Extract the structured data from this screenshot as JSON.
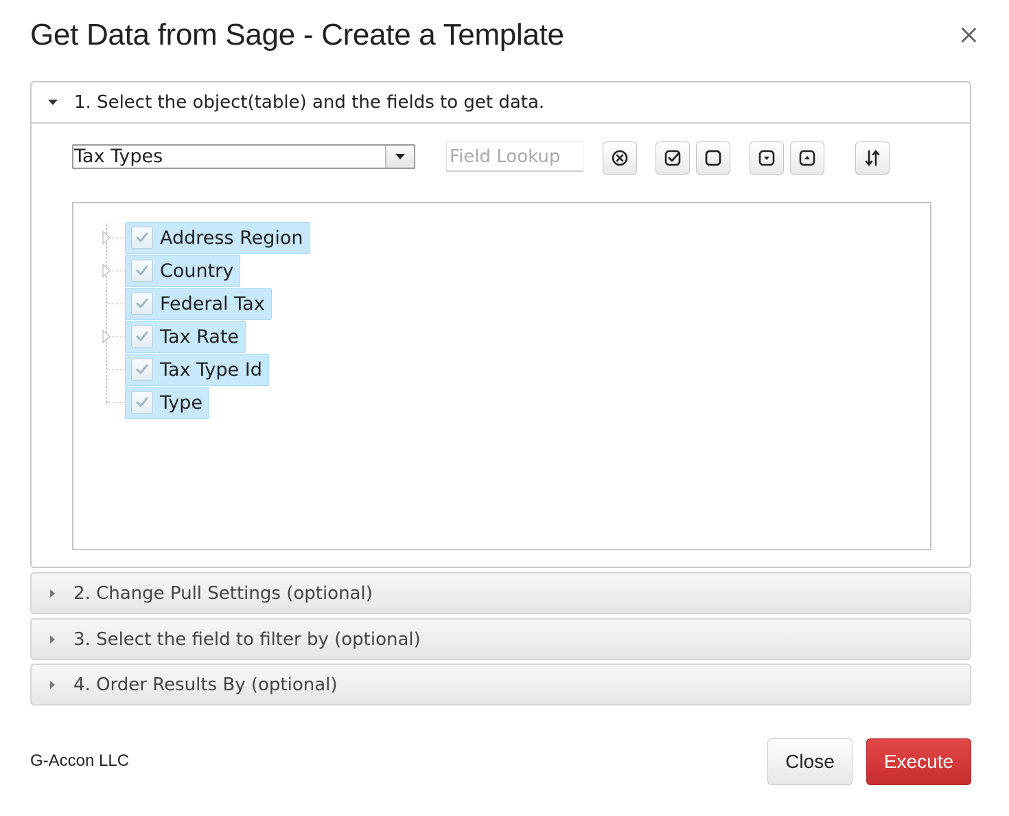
{
  "dialog": {
    "title": "Get Data from Sage - Create a Template"
  },
  "section1": {
    "label": "1. Select the object(table) and the fields to get data.",
    "expanded": true,
    "object_select": {
      "value": "Tax Types"
    },
    "field_lookup": {
      "placeholder": "Field Lookup",
      "value": ""
    },
    "toolbar": [
      {
        "name": "clear-lookup",
        "icon": "circle-x-icon"
      },
      {
        "name": "check-all",
        "icon": "check-square-icon"
      },
      {
        "name": "uncheck-all",
        "icon": "empty-square-icon"
      },
      {
        "name": "expand-all",
        "icon": "square-chevron-down-icon"
      },
      {
        "name": "collapse-all",
        "icon": "square-chevron-up-icon"
      },
      {
        "name": "sort-fields",
        "icon": "sort-arrows-icon"
      }
    ],
    "fields": [
      {
        "label": "Address Region",
        "checked": true,
        "expandable": true
      },
      {
        "label": "Country",
        "checked": true,
        "expandable": true
      },
      {
        "label": "Federal Tax",
        "checked": true,
        "expandable": false
      },
      {
        "label": "Tax Rate",
        "checked": true,
        "expandable": true
      },
      {
        "label": "Tax Type Id",
        "checked": true,
        "expandable": false
      },
      {
        "label": "Type",
        "checked": true,
        "expandable": false
      }
    ]
  },
  "section2": {
    "label": "2. Change Pull Settings (optional)",
    "expanded": false
  },
  "section3": {
    "label": "3. Select the field to filter by (optional)",
    "expanded": false
  },
  "section4": {
    "label": "4. Order Results By (optional)",
    "expanded": false
  },
  "footer": {
    "brand": "G-Accon LLC",
    "close_label": "Close",
    "execute_label": "Execute"
  },
  "colors": {
    "execute_bg": "#d63a3a",
    "selected_field_bg": "#c7e9fb"
  }
}
